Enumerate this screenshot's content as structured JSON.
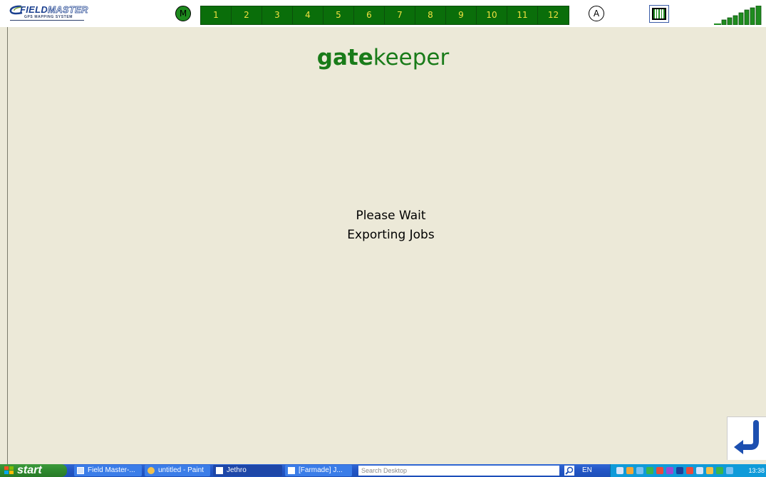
{
  "header": {
    "logo": {
      "word1": "FIELD",
      "word2": "MASTER",
      "tagline": "GPS MAPPING SYSTEM"
    },
    "mode_manual": "M",
    "mode_auto": "A",
    "sections": [
      "1",
      "2",
      "3",
      "4",
      "5",
      "6",
      "7",
      "8",
      "9",
      "10",
      "11",
      "12"
    ],
    "icons": {
      "layout": "boom-grid-icon",
      "signal": "signal-strength-icon"
    }
  },
  "main": {
    "brand_bold": "gate",
    "brand_rest": "keeper",
    "status_line1": "Please Wait",
    "status_line2": "Exporting Jobs",
    "back_icon": "return-arrow-icon"
  },
  "taskbar": {
    "start_label": "start",
    "tasks": [
      {
        "label": "Field Master-...",
        "icon": "window-icon"
      },
      {
        "label": "untitled - Paint",
        "icon": "paint-icon"
      },
      {
        "label": "Jethro",
        "icon": "app-icon"
      },
      {
        "label": "[Farmade] J...",
        "icon": "app-icon"
      }
    ],
    "search_placeholder": "Search Desktop",
    "language": "EN",
    "clock": "13:38"
  },
  "colors": {
    "background": "#ece9d8",
    "brand_green": "#197b19",
    "section_green": "#0a6e0a",
    "section_text": "#f0e040"
  }
}
